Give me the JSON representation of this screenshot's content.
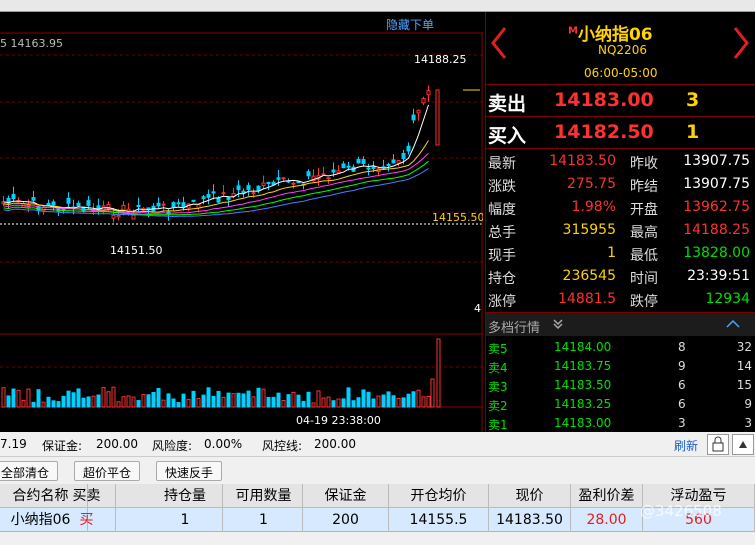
{
  "chart": {
    "hide_orders_link": "隐藏下单",
    "ma_label": "5 14163.95",
    "high_label": "14188.25",
    "low_label": "14151.50",
    "ref_line_label": "14155.50",
    "vol_axis_label": "4",
    "time_label": "04-19 23:38:00"
  },
  "symbol": {
    "name": "小纳指06",
    "badge": "M",
    "code": "NQ2206",
    "session": "06:00-05:00"
  },
  "ask": {
    "label": "卖出",
    "price": "14183.00",
    "vol": "3"
  },
  "bid": {
    "label": "买入",
    "price": "14182.50",
    "vol": "1"
  },
  "quote": [
    {
      "l1": "最新",
      "v1": "14183.50",
      "c1": "red",
      "l2": "昨收",
      "v2": "13907.75",
      "c2": "white"
    },
    {
      "l1": "涨跌",
      "v1": "275.75",
      "c1": "red",
      "l2": "昨结",
      "v2": "13907.75",
      "c2": "white"
    },
    {
      "l1": "幅度",
      "v1": "1.98%",
      "c1": "red",
      "l2": "开盘",
      "v2": "13962.75",
      "c2": "red"
    },
    {
      "l1": "总手",
      "v1": "315955",
      "c1": "yellow",
      "l2": "最高",
      "v2": "14188.25",
      "c2": "red"
    },
    {
      "l1": "现手",
      "v1": "1",
      "c1": "yellow",
      "l2": "最低",
      "v2": "13828.00",
      "c2": "green"
    },
    {
      "l1": "持仓",
      "v1": "236545",
      "c1": "yellow",
      "l2": "时间",
      "v2": "23:39:51",
      "c2": "white"
    },
    {
      "l1": "涨停",
      "v1": "14881.5",
      "c1": "red",
      "l2": "跌停",
      "v2": "12934",
      "c2": "green"
    }
  ],
  "depth": {
    "title": "多档行情",
    "rows": [
      {
        "label": "卖5",
        "price": "14184.00",
        "vol": "8",
        "count": "32"
      },
      {
        "label": "卖4",
        "price": "14183.75",
        "vol": "9",
        "count": "14"
      },
      {
        "label": "卖3",
        "price": "14183.50",
        "vol": "6",
        "count": "15"
      },
      {
        "label": "卖2",
        "price": "14183.25",
        "vol": "6",
        "count": "9"
      },
      {
        "label": "卖1",
        "price": "14183.00",
        "vol": "3",
        "count": "3"
      }
    ]
  },
  "account": {
    "equity_tail": "7.19",
    "margin_label": "保证金:",
    "margin_value": "200.00",
    "risk_label": "风险度:",
    "risk_value": "0.00%",
    "control_label": "风控线:",
    "control_value": "200.00",
    "refresh": "刷新"
  },
  "buttons": {
    "close_all": "全部清仓",
    "over_close": "超价平仓",
    "quick_reverse": "快速反手"
  },
  "table": {
    "headers": [
      "合约名称",
      "买卖",
      "持仓量",
      "可用数量",
      "保证金",
      "开仓均价",
      "现价",
      "盈利价差",
      "浮动盈亏"
    ],
    "row": [
      "小纳指06",
      "买",
      "1",
      "1",
      "200",
      "14155.5",
      "14183.50",
      "28.00",
      "560"
    ]
  },
  "watermark": "@3426508"
}
